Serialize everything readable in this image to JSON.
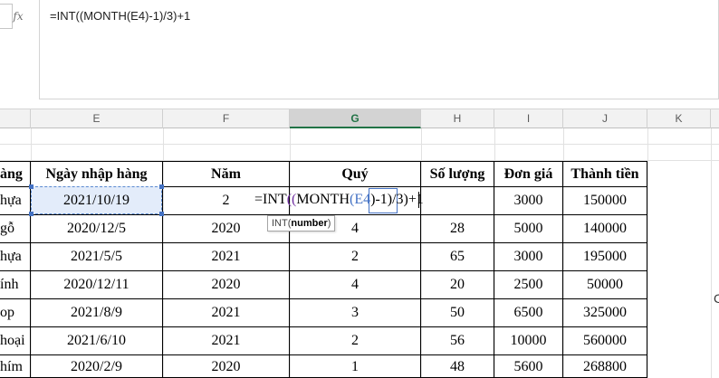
{
  "formula_bar": {
    "fx_label": "fx",
    "formula": "=INT((MONTH(E4)-1)/3)+1"
  },
  "columns": [
    {
      "id": "E",
      "label": "E"
    },
    {
      "id": "F",
      "label": "F"
    },
    {
      "id": "G",
      "label": "G",
      "selected": true
    },
    {
      "id": "H",
      "label": "H"
    },
    {
      "id": "I",
      "label": "I"
    },
    {
      "id": "J",
      "label": "J"
    },
    {
      "id": "K",
      "label": "K"
    }
  ],
  "table": {
    "headers": {
      "d_frag": "àng",
      "e": "Ngày nhập hàng",
      "f": "Năm",
      "g": "Quý",
      "h": "Số lượng",
      "i": "Đơn giá",
      "j": "Thành tiền"
    },
    "rows": [
      {
        "d": "hựa",
        "e": "2021/10/19",
        "f": "2",
        "g": "",
        "h": "",
        "i": "3000",
        "j": "150000"
      },
      {
        "d": "gỗ",
        "e": "2020/12/5",
        "f": "2020",
        "g": "4",
        "h": "28",
        "i": "5000",
        "j": "140000"
      },
      {
        "d": "hựa",
        "e": "2021/5/5",
        "f": "2021",
        "g": "2",
        "h": "65",
        "i": "3000",
        "j": "195000"
      },
      {
        "d": "ính",
        "e": "2020/12/11",
        "f": "2020",
        "g": "4",
        "h": "20",
        "i": "2500",
        "j": "50000"
      },
      {
        "d": "op",
        "e": "2021/8/9",
        "f": "2021",
        "g": "3",
        "h": "50",
        "i": "6500",
        "j": "325000"
      },
      {
        "d": "hoại",
        "e": "2021/6/10",
        "f": "2021",
        "g": "2",
        "h": "56",
        "i": "10000",
        "j": "560000"
      },
      {
        "d": "hím",
        "e": "2020/2/9",
        "f": "2020",
        "g": "1",
        "h": "48",
        "i": "5600",
        "j": "268800"
      }
    ]
  },
  "editing": {
    "prefix": "=INT",
    "paren_open": "((",
    "fn": "MONTH",
    "paren_fn": "(",
    "ref": "E4",
    "rest": ")-1)/3)+1"
  },
  "tooltip": {
    "fn": "INT",
    "arg": "number"
  },
  "right_fragments": {
    "row2": "",
    "row5": "C"
  }
}
